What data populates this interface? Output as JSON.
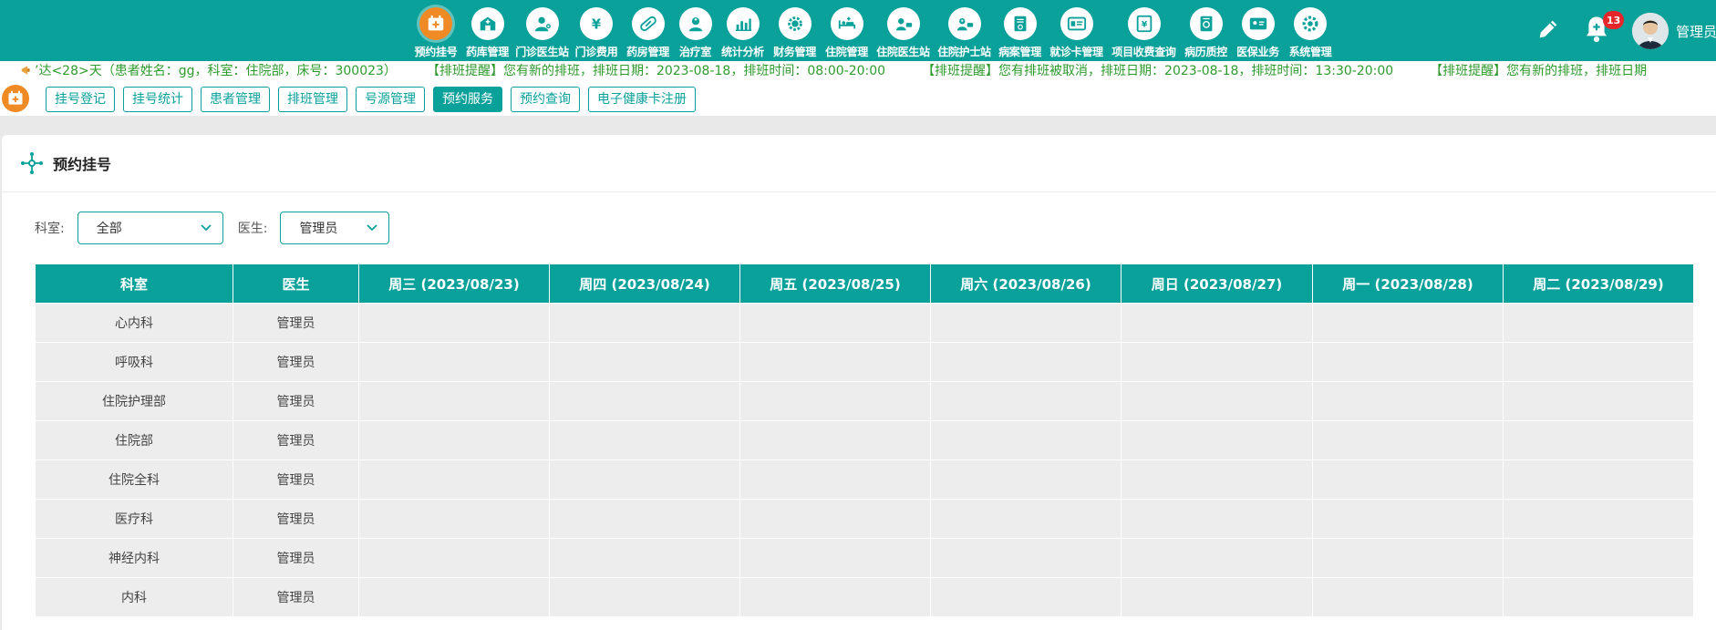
{
  "nav": {
    "items": [
      {
        "label": "预约挂号",
        "icon": "calendar-plus-icon",
        "active": true
      },
      {
        "label": "药库管理",
        "icon": "warehouse-icon"
      },
      {
        "label": "门诊医生站",
        "icon": "doctor-icon"
      },
      {
        "label": "门诊费用",
        "icon": "yen-icon"
      },
      {
        "label": "药房管理",
        "icon": "pill-icon"
      },
      {
        "label": "治疗室",
        "icon": "nurse-icon"
      },
      {
        "label": "统计分析",
        "icon": "bar-chart-icon"
      },
      {
        "label": "财务管理",
        "icon": "gear-money-icon"
      },
      {
        "label": "住院管理",
        "icon": "bed-icon"
      },
      {
        "label": "住院医生站",
        "icon": "doctor-card-icon"
      },
      {
        "label": "住院护士站",
        "icon": "nurse-card-icon"
      },
      {
        "label": "病案管理",
        "icon": "file-icon"
      },
      {
        "label": "就诊卡管理",
        "icon": "id-card-icon"
      },
      {
        "label": "项目收费查询",
        "icon": "invoice-icon"
      },
      {
        "label": "病历质控",
        "icon": "record-icon"
      },
      {
        "label": "医保业务",
        "icon": "insurance-card-icon"
      },
      {
        "label": "系统管理",
        "icon": "settings-icon"
      }
    ]
  },
  "header": {
    "notification_count": "13",
    "username": "管理员"
  },
  "marquee": {
    "messages": [
      "’达<28>天（患者姓名：gg，科室：住院部，床号：300023）",
      "【排班提醒】您有新的排班，排班日期：2023-08-18，排班时间：08:00-20:00",
      "【排班提醒】您有排班被取消，排班日期：2023-08-18，排班时间：13:30-20:00",
      "【排班提醒】您有新的排班，排班日期"
    ]
  },
  "tabs": [
    {
      "label": "挂号登记"
    },
    {
      "label": "挂号统计"
    },
    {
      "label": "患者管理"
    },
    {
      "label": "排班管理"
    },
    {
      "label": "号源管理"
    },
    {
      "label": "预约服务",
      "active": true
    },
    {
      "label": "预约查询"
    },
    {
      "label": "电子健康卡注册"
    }
  ],
  "page": {
    "title": "预约挂号"
  },
  "filters": {
    "dept_label": "科室:",
    "dept_value": "全部",
    "doctor_label": "医生:",
    "doctor_value": "管理员"
  },
  "table": {
    "headers": [
      "科室",
      "医生",
      "周三 (2023/08/23)",
      "周四 (2023/08/24)",
      "周五 (2023/08/25)",
      "周六 (2023/08/26)",
      "周日 (2023/08/27)",
      "周一 (2023/08/28)",
      "周二 (2023/08/29)"
    ],
    "rows": [
      {
        "dept": "心内科",
        "doctor": "管理员"
      },
      {
        "dept": "呼吸科",
        "doctor": "管理员"
      },
      {
        "dept": "住院护理部",
        "doctor": "管理员"
      },
      {
        "dept": "住院部",
        "doctor": "管理员"
      },
      {
        "dept": "住院全科",
        "doctor": "管理员"
      },
      {
        "dept": "医疗科",
        "doctor": "管理员"
      },
      {
        "dept": "神经内科",
        "doctor": "管理员"
      },
      {
        "dept": "内科",
        "doctor": "管理员"
      }
    ]
  },
  "colors": {
    "primary": "#0aa19b",
    "accent": "#f08a24",
    "notice": "#2e9b2e",
    "badge": "#e5262b"
  }
}
